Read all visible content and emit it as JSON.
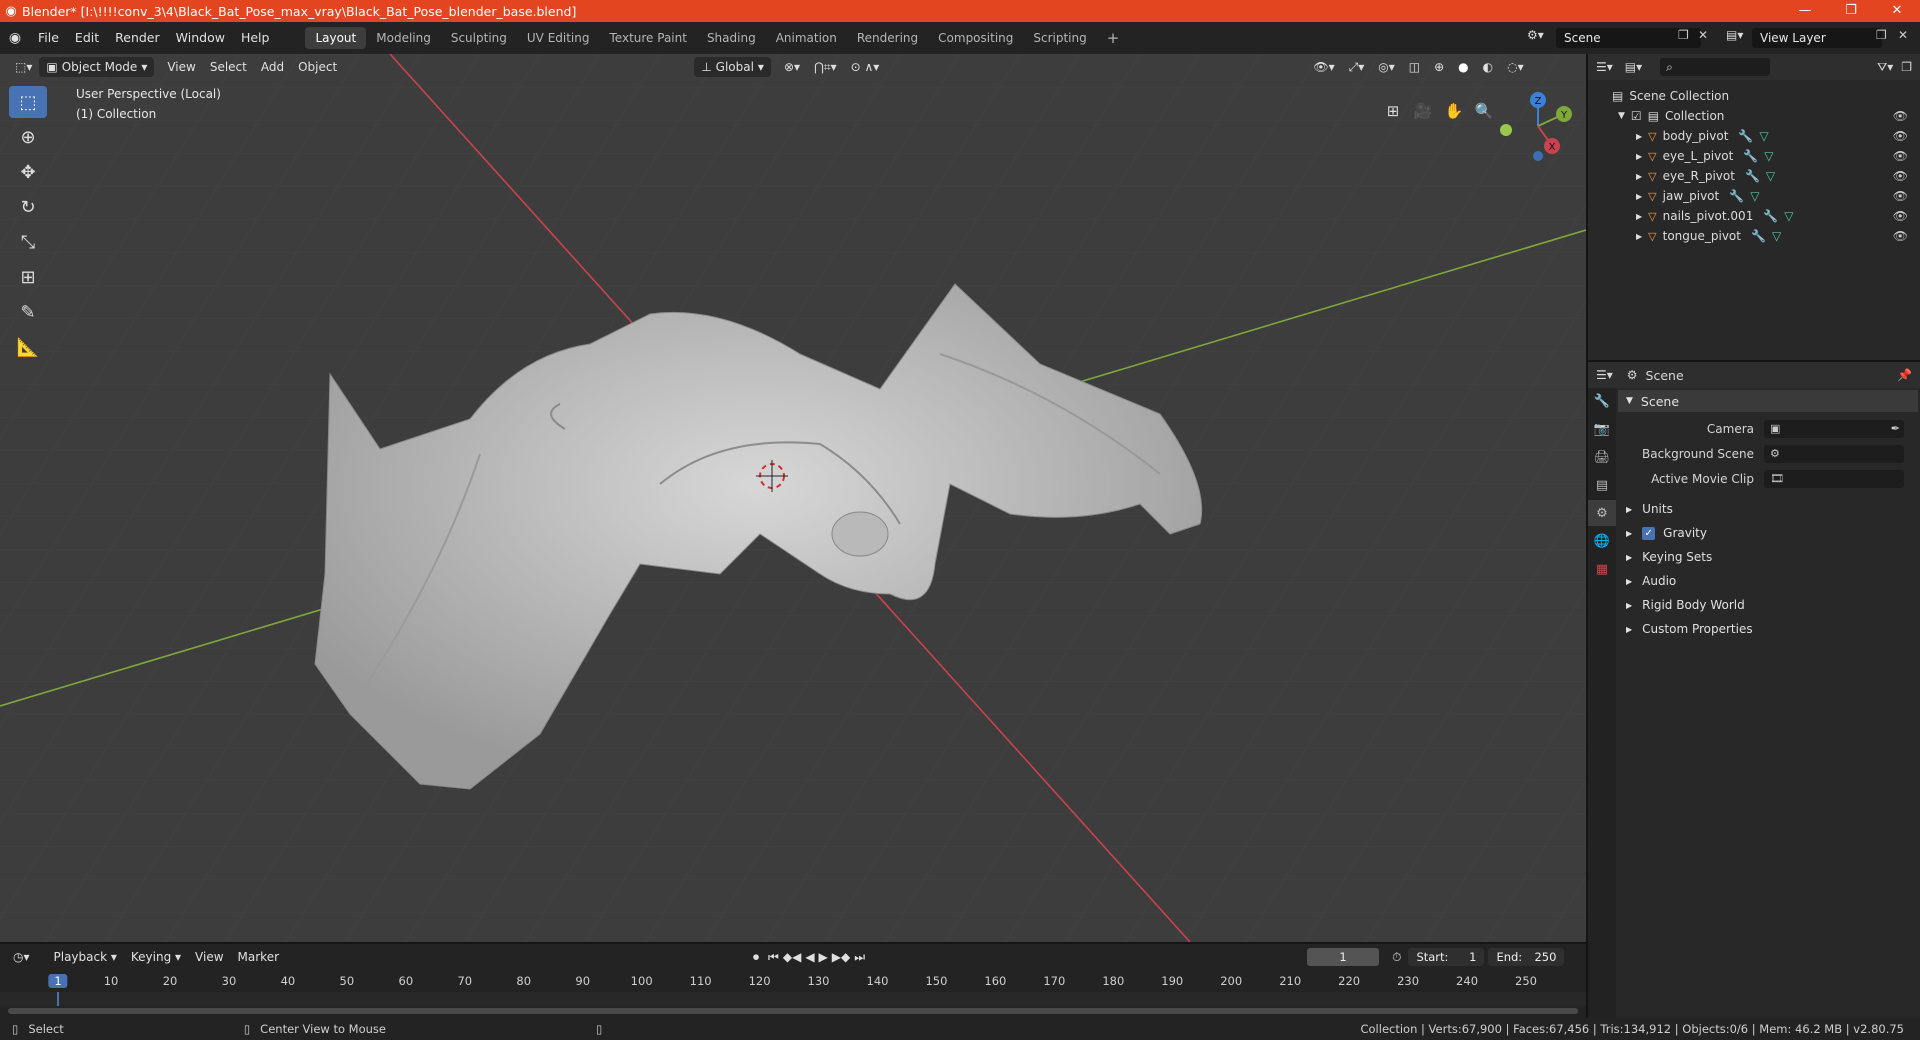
{
  "window": {
    "title": "Blender* [I:\\!!!!conv_3\\4\\Black_Bat_Pose_max_vray\\Black_Bat_Pose_blender_base.blend]",
    "controls": [
      "—",
      "❐",
      "✕"
    ]
  },
  "menu": [
    "File",
    "Edit",
    "Render",
    "Window",
    "Help"
  ],
  "workspaces": [
    {
      "label": "Layout",
      "active": true
    },
    {
      "label": "Modeling",
      "active": false
    },
    {
      "label": "Sculpting",
      "active": false
    },
    {
      "label": "UV Editing",
      "active": false
    },
    {
      "label": "Texture Paint",
      "active": false
    },
    {
      "label": "Shading",
      "active": false
    },
    {
      "label": "Animation",
      "active": false
    },
    {
      "label": "Rendering",
      "active": false
    },
    {
      "label": "Compositing",
      "active": false
    },
    {
      "label": "Scripting",
      "active": false
    }
  ],
  "scene_selector": {
    "value": "Scene"
  },
  "view_layer_selector": {
    "value": "View Layer"
  },
  "viewport": {
    "mode": "Object Mode",
    "menus": [
      "View",
      "Select",
      "Add",
      "Object"
    ],
    "orientation": "Global",
    "info_line1": "User Perspective (Local)",
    "info_line2": "(1) Collection",
    "gizmo_axes": {
      "x": "X",
      "y": "Y",
      "z": "Z"
    }
  },
  "outliner": {
    "root": "Scene Collection",
    "collection": "Collection",
    "objects": [
      "body_pivot",
      "eye_L_pivot",
      "eye_R_pivot",
      "jaw_pivot",
      "nails_pivot.001",
      "tongue_pivot"
    ]
  },
  "properties": {
    "header": "Scene",
    "panel_title": "Scene",
    "fields": [
      {
        "label": "Camera",
        "value": ""
      },
      {
        "label": "Background Scene",
        "value": ""
      },
      {
        "label": "Active Movie Clip",
        "value": ""
      }
    ],
    "subpanels": [
      {
        "label": "Units",
        "checkbox": false
      },
      {
        "label": "Gravity",
        "checkbox": true,
        "checked": true
      },
      {
        "label": "Keying Sets",
        "checkbox": false
      },
      {
        "label": "Audio",
        "checkbox": false
      },
      {
        "label": "Rigid Body World",
        "checkbox": false
      },
      {
        "label": "Custom Properties",
        "checkbox": false
      }
    ]
  },
  "timeline": {
    "menus": [
      "Playback",
      "Keying",
      "View",
      "Marker"
    ],
    "current_frame": "1",
    "start_label": "Start:",
    "start_value": "1",
    "end_label": "End:",
    "end_value": "250",
    "ticks": [
      "1",
      "10",
      "20",
      "30",
      "40",
      "50",
      "60",
      "70",
      "80",
      "90",
      "100",
      "110",
      "120",
      "130",
      "140",
      "150",
      "160",
      "170",
      "180",
      "190",
      "200",
      "210",
      "220",
      "230",
      "240",
      "250"
    ]
  },
  "statusbar": {
    "left_action": "Select",
    "middle_action": "Center View to Mouse",
    "stats": "Collection | Verts:67,900 | Faces:67,456 | Tris:134,912 | Objects:0/6 | Mem: 46.2 MB | v2.80.75"
  },
  "colors": {
    "titlebar": "#e2451f",
    "accent": "#4772b3",
    "viewport_bg": "#3d3d3d",
    "x_axis": "#c8434f",
    "y_axis": "#7fa83b",
    "object_orange": "#f29a4a"
  }
}
